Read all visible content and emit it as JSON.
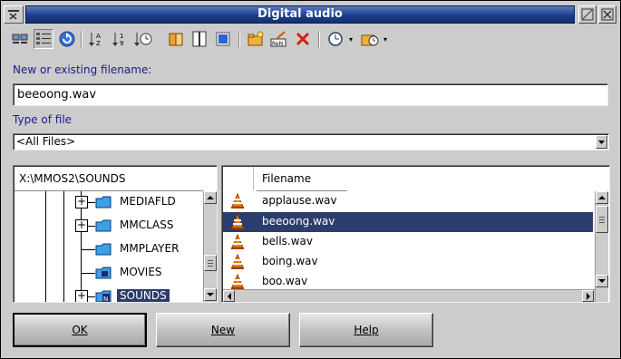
{
  "window": {
    "title": "Digital audio"
  },
  "toolbar": {
    "icons": [
      "icon-view-icon",
      "details-view-icon",
      "refresh-icon",
      "sort-name-icon",
      "sort-size-icon",
      "sort-date-icon",
      "open-folder-icon",
      "split-pane-icon",
      "stop-icon",
      "new-folder-icon",
      "rename-icon",
      "delete-icon",
      "history-icon",
      "history-folder-icon"
    ]
  },
  "filename": {
    "label": "New or existing filename:",
    "value": "beeoong.wav"
  },
  "filetype": {
    "label": "Type of file",
    "value": "<All Files>"
  },
  "tree": {
    "path": "X:\\MMOS2\\SOUNDS",
    "items": [
      {
        "name": "MEDIAFLD",
        "expandable": true
      },
      {
        "name": "MMCLASS",
        "expandable": true
      },
      {
        "name": "MMPLAYER",
        "expandable": false
      },
      {
        "name": "MOVIES",
        "expandable": false
      },
      {
        "name": "SOUNDS",
        "expandable": true,
        "selected": true
      }
    ]
  },
  "files": {
    "column_header": "Filename",
    "items": [
      {
        "name": "applause.wav"
      },
      {
        "name": "beeoong.wav",
        "selected": true
      },
      {
        "name": "bells.wav"
      },
      {
        "name": "boing.wav"
      },
      {
        "name": "boo.wav"
      }
    ]
  },
  "buttons": {
    "ok": "OK",
    "new": "New",
    "help": "Help"
  },
  "colors": {
    "selection": "#2b3d6c",
    "label_text": "#1a1a8c",
    "title_bar": "#1c3d8a"
  }
}
